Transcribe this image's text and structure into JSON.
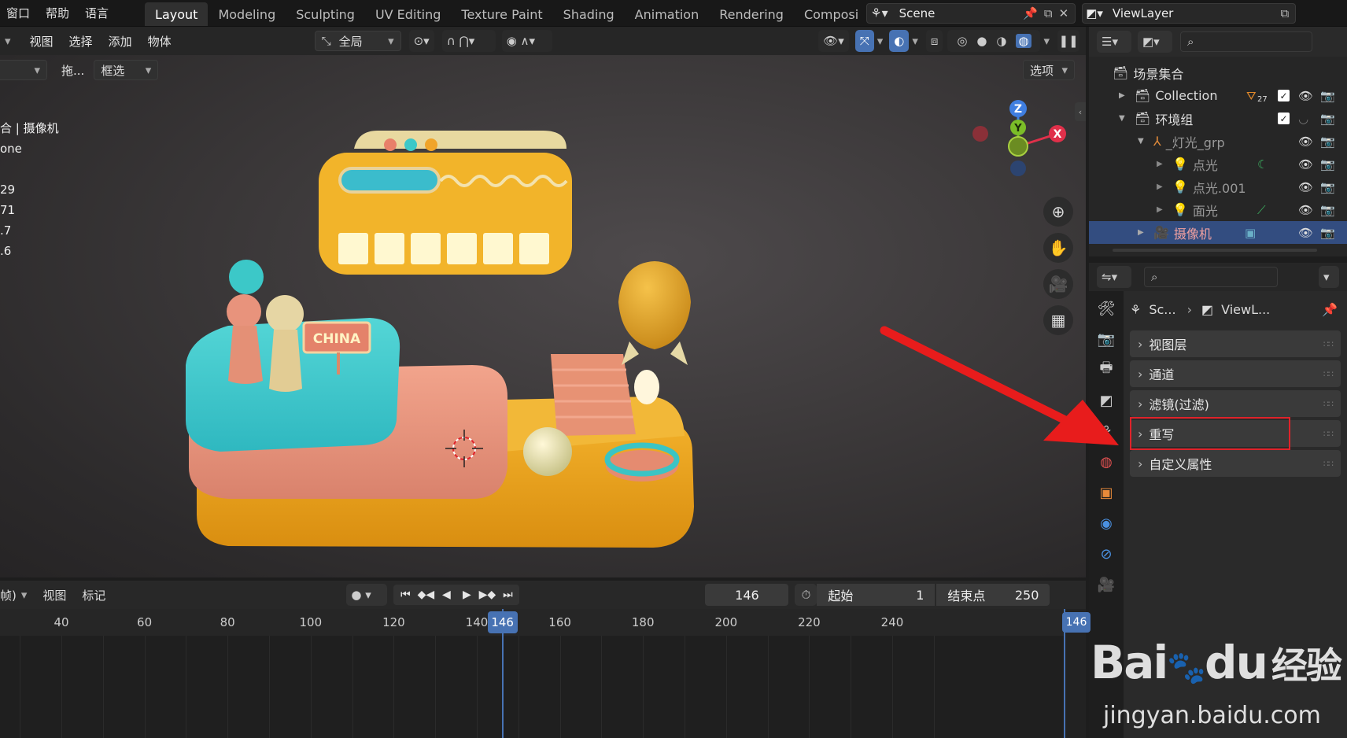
{
  "topbar": {
    "menus": [
      "窗口",
      "帮助",
      "语言"
    ],
    "workspaces": [
      "Layout",
      "Modeling",
      "Sculpting",
      "UV Editing",
      "Texture Paint",
      "Shading",
      "Animation",
      "Rendering",
      "Composi"
    ],
    "active_workspace": "Layout",
    "scene_name": "Scene",
    "viewlayer_name": "ViewLayer"
  },
  "viewport": {
    "menus": [
      "视图",
      "选择",
      "添加",
      "物体"
    ],
    "transform_orientation": "全局",
    "drag_label": "拖...",
    "select_mode": "框选",
    "options_label": "选项",
    "overlay_text": [
      "合 | 摄像机",
      "one",
      "",
      "29",
      "71",
      ".7",
      ".6"
    ],
    "sign_text": "CHINA",
    "gizmo": {
      "z": "Z",
      "y": "Y",
      "x": "X"
    }
  },
  "outliner": {
    "search_placeholder": "",
    "rows": [
      {
        "label": "场景集合",
        "level": 0,
        "type": "scene-collection"
      },
      {
        "label": "Collection",
        "level": 1,
        "type": "collection",
        "badge": "27"
      },
      {
        "label": "环境组",
        "level": 1,
        "type": "collection"
      },
      {
        "label": "_灯光_grp",
        "level": 2,
        "type": "empty"
      },
      {
        "label": "点光",
        "level": 3,
        "type": "light"
      },
      {
        "label": "点光.001",
        "level": 3,
        "type": "light"
      },
      {
        "label": "面光",
        "level": 3,
        "type": "light"
      },
      {
        "label": "摄像机",
        "level": 2,
        "type": "camera",
        "selected": true
      }
    ]
  },
  "properties": {
    "breadcrumb_scene": "Sc...",
    "breadcrumb_viewlayer": "ViewL...",
    "panels": [
      "视图层",
      "通道",
      "滤镜(过滤)",
      "重写",
      "自定义属性"
    ],
    "highlighted_panel": "重写"
  },
  "timeline": {
    "menus": [
      "帧)",
      "视图",
      "标记"
    ],
    "current_frame": "146",
    "start_label": "起始",
    "start_value": "1",
    "end_label": "结束点",
    "end_value": "250",
    "ruler_ticks": [
      "40",
      "60",
      "80",
      "100",
      "120",
      "140",
      "160",
      "180",
      "200",
      "220",
      "240"
    ],
    "playhead_label": "146",
    "end_marker_label": "146"
  },
  "watermark": {
    "brand": "Bai",
    "brand2": "du",
    "cn": "经验",
    "url": "jingyan.baidu.com"
  },
  "colors": {
    "accent_blue": "#4772b3",
    "highlight_red": "#e0222a",
    "arrow_red": "#e81c1c",
    "selected_row": "#334d80"
  }
}
